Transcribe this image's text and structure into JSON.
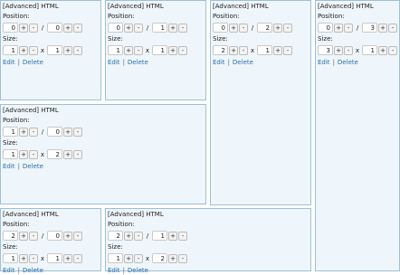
{
  "widgets": [
    {
      "title": "[Advanced] HTML",
      "position_label": "Position:",
      "size_label": "Size:",
      "pos_x": "0",
      "pos_y": "0",
      "size_w": "1",
      "size_h": "1",
      "edit": "Edit",
      "delete": "Delete"
    },
    {
      "title": "[Advanced] HTML",
      "position_label": "Position:",
      "size_label": "Size:",
      "pos_x": "0",
      "pos_y": "1",
      "size_w": "1",
      "size_h": "1",
      "edit": "Edit",
      "delete": "Delete"
    },
    {
      "title": "[Advanced] HTML",
      "position_label": "Position:",
      "size_label": "Size:",
      "pos_x": "0",
      "pos_y": "2",
      "size_w": "2",
      "size_h": "1",
      "edit": "Edit",
      "delete": "Delete"
    },
    {
      "title": "[Advanced] HTML",
      "position_label": "Position:",
      "size_label": "Size:",
      "pos_x": "0",
      "pos_y": "3",
      "size_w": "3",
      "size_h": "1",
      "edit": "Edit",
      "delete": "Delete"
    },
    {
      "title": "[Advanced] HTML",
      "position_label": "Position:",
      "size_label": "Size:",
      "pos_x": "1",
      "pos_y": "0",
      "size_w": "1",
      "size_h": "2",
      "edit": "Edit",
      "delete": "Delete"
    },
    {
      "title": "[Advanced] HTML",
      "position_label": "Position:",
      "size_label": "Size:",
      "pos_x": "2",
      "pos_y": "0",
      "size_w": "1",
      "size_h": "1",
      "edit": "Edit",
      "delete": "Delete"
    },
    {
      "title": "[Advanced] HTML",
      "position_label": "Position:",
      "size_label": "Size:",
      "pos_x": "2",
      "pos_y": "1",
      "size_w": "1",
      "size_h": "2",
      "edit": "Edit",
      "delete": "Delete"
    }
  ],
  "controls": {
    "plus": "+",
    "minus": "-",
    "pos_sep": "/",
    "size_sep": "x",
    "action_sep": "|"
  }
}
